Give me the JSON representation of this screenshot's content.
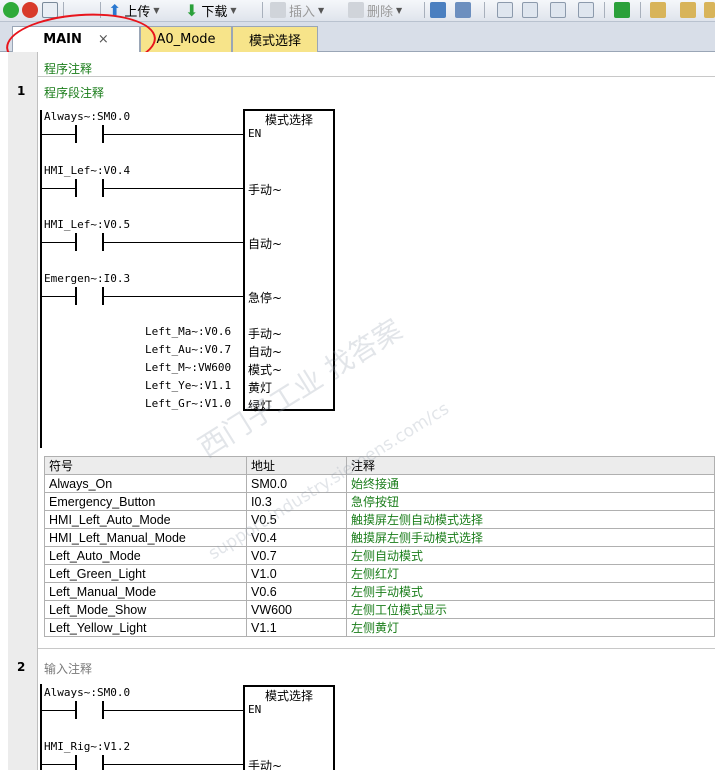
{
  "toolbar": {
    "upload_label": "上传",
    "download_label": "下载",
    "insert_label": "插入",
    "delete_label": "删除"
  },
  "tabs": [
    {
      "label": "MAIN",
      "close": "×"
    },
    {
      "label": "A0_Mode"
    },
    {
      "label": "模式选择"
    }
  ],
  "program_comment": "程序注释",
  "networks": [
    {
      "number": "1",
      "comment": "程序段注释",
      "contacts": [
        "Always~:SM0.0",
        "HMI_Lef~:V0.4",
        "HMI_Lef~:V0.5",
        "Emergen~:I0.3"
      ],
      "box_title": "模式选择",
      "input_pins": [
        "EN",
        "手动~",
        "自动~",
        "急停~"
      ],
      "output_pins": [
        {
          "var": "Left_Ma~:V0.6",
          "pin": "手动~"
        },
        {
          "var": "Left_Au~:V0.7",
          "pin": "自动~"
        },
        {
          "var": "Left_M~:VW600",
          "pin": "模式~"
        },
        {
          "var": "Left_Ye~:V1.1",
          "pin": "黄灯"
        },
        {
          "var": "Left_Gr~:V1.0",
          "pin": "绿灯"
        }
      ],
      "symbol_table": {
        "headers": [
          "符号",
          "地址",
          "注释"
        ],
        "rows": [
          [
            "Always_On",
            "SM0.0",
            "始终接通"
          ],
          [
            "Emergency_Button",
            "I0.3",
            "急停按钮"
          ],
          [
            "HMI_Left_Auto_Mode",
            "V0.5",
            "触摸屏左侧自动模式选择"
          ],
          [
            "HMI_Left_Manual_Mode",
            "V0.4",
            "触摸屏左侧手动模式选择"
          ],
          [
            "Left_Auto_Mode",
            "V0.7",
            "左侧自动模式"
          ],
          [
            "Left_Green_Light",
            "V1.0",
            "左侧红灯"
          ],
          [
            "Left_Manual_Mode",
            "V0.6",
            "左侧手动模式"
          ],
          [
            "Left_Mode_Show",
            "VW600",
            "左侧工位模式显示"
          ],
          [
            "Left_Yellow_Light",
            "V1.1",
            "左侧黄灯"
          ]
        ]
      }
    },
    {
      "number": "2",
      "comment": "输入注释",
      "contacts": [
        "Always~:SM0.0",
        "HMI_Rig~:V1.2"
      ],
      "box_title": "模式选择",
      "input_pins": [
        "EN",
        "手动~"
      ]
    }
  ],
  "watermark": {
    "line1": "西门子工业 找答案",
    "line2": "support.industry.siemens.com/cs"
  },
  "colors": {
    "comment_green": "#1a7d1a",
    "annotation_red": "#e8141c",
    "tab_yellow": "#f7e48a"
  }
}
